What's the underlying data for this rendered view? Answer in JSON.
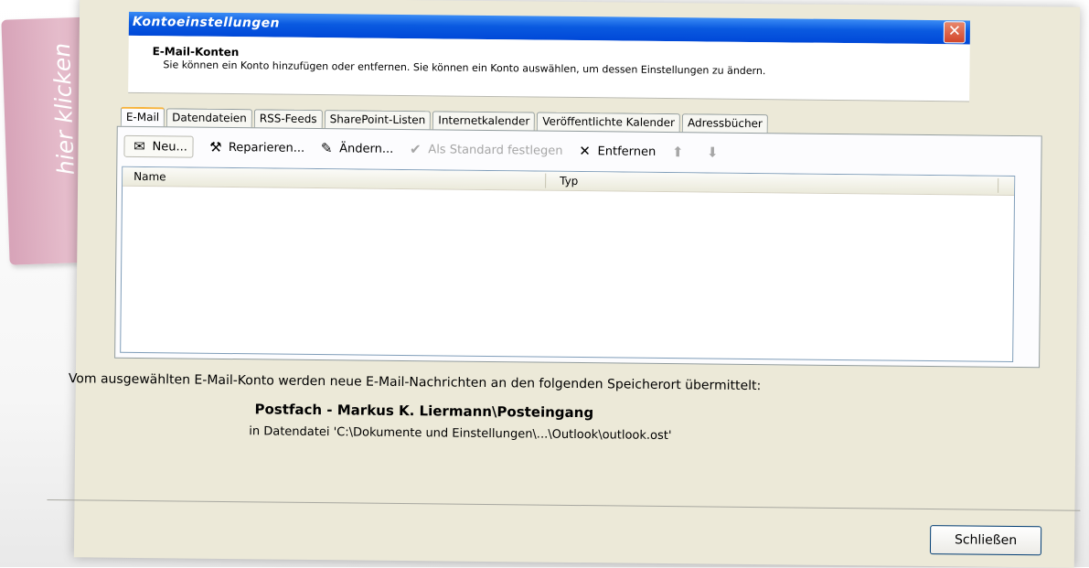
{
  "annotation": {
    "label": "hier klicken"
  },
  "window": {
    "title": "Kontoeinstellungen"
  },
  "header": {
    "title": "E-Mail-Konten",
    "description": "Sie können ein Konto hinzufügen oder entfernen. Sie können ein Konto auswählen, um dessen Einstellungen zu ändern."
  },
  "tabs": [
    {
      "label": "E-Mail",
      "active": true
    },
    {
      "label": "Datendateien"
    },
    {
      "label": "RSS-Feeds"
    },
    {
      "label": "SharePoint-Listen"
    },
    {
      "label": "Internetkalender"
    },
    {
      "label": "Veröffentlichte Kalender"
    },
    {
      "label": "Adressbücher"
    }
  ],
  "toolbar": {
    "new_label": "Neu...",
    "repair_label": "Reparieren...",
    "change_label": "Ändern...",
    "default_label": "Als Standard festlegen",
    "remove_label": "Entfernen"
  },
  "list": {
    "columns": [
      "Name",
      "Typ"
    ],
    "rows": []
  },
  "delivery": {
    "info": "Vom ausgewählten E-Mail-Konto werden neue E-Mail-Nachrichten an den folgenden Speicherort übermittelt:",
    "mailbox": "Postfach - Markus K. Liermann\\Posteingang",
    "datafile": "in Datendatei 'C:\\Dokumente und Einstellungen\\...\\Outlook\\outlook.ost'"
  },
  "footer": {
    "close_label": "Schließen"
  },
  "colors": {
    "titlebar": "#0a5ae0",
    "dialog_bg": "#ece9d8",
    "note": "#dcaebf",
    "tab_highlight": "#f7b33b"
  }
}
